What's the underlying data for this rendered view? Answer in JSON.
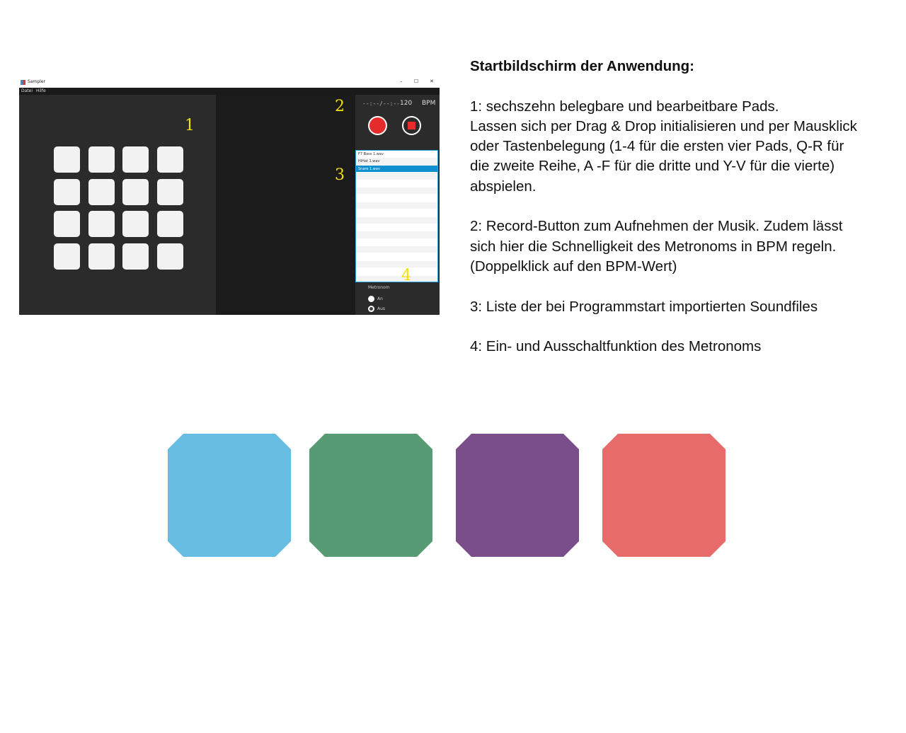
{
  "app": {
    "window_title": "Sampler",
    "window_controls": [
      "–",
      "☐",
      "✕"
    ],
    "menu": [
      "Datei",
      "Hilfe"
    ],
    "timecode": "--:--/--:--",
    "bpm_value": "120",
    "bpm_unit": "BPM",
    "sounds": [
      "F7 Bass 1.wav",
      "HiHat 1.wav",
      "Snare 1.wav"
    ],
    "selected_sound_index": 2,
    "metronome_label": "Metronom",
    "metronome_options": [
      "An",
      "Aus"
    ],
    "metronome_selected": "Aus",
    "markers": [
      "1",
      "2",
      "3",
      "4"
    ],
    "pad_count": 16
  },
  "description": {
    "heading": "Startbildschirm der Anwendung:",
    "item1_line1": "1: sechszehn belegbare und bearbeitbare Pads.",
    "item1_line2": "Lassen sich per Drag & Drop initialisieren und per Mausklick",
    "item1_line3": "oder Tastenbelegung (1-4 für die ersten vier Pads,  Q-R für",
    "item1_line4": "die zweite Reihe, A -F für die dritte und Y-V für die vierte)",
    "item1_line5": "abspielen.",
    "item2_line1": "2: Record-Button zum Aufnehmen der Musik. Zudem lässt",
    "item2_line2": "sich hier die Schnelligkeit des Metronoms in BPM regeln.",
    "item2_line3": "(Doppelklick auf den BPM-Wert)",
    "item3": "3: Liste der bei Programmstart importierten Soundfiles",
    "item4": "4: Ein- und Ausschaltfunktion des Metronoms"
  },
  "swatches": [
    "#68bde3",
    "#579b74",
    "#7a4e89",
    "#e66b69"
  ]
}
